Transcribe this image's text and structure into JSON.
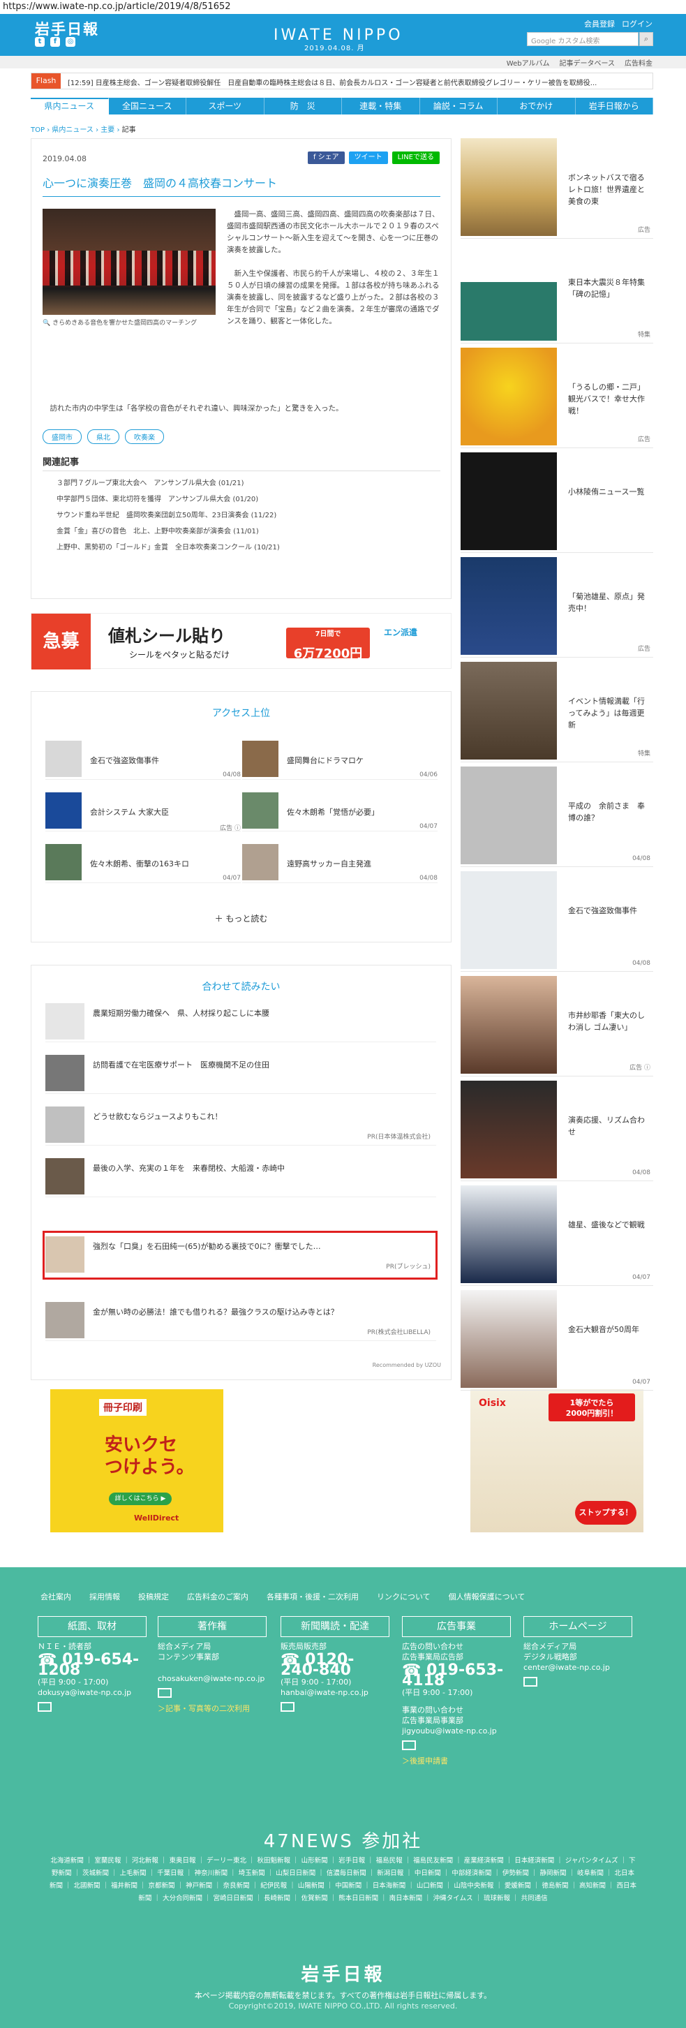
{
  "url": "https://www.iwate-np.co.jp/article/2019/4/8/51652",
  "header": {
    "logo_jp": "岩手日報",
    "logo_en": "IWATE NIPPO",
    "date": "2019.04.08. 月",
    "member_link": "会員登録",
    "login_link": "ログイン",
    "search_placeholder": "Google カスタム検索"
  },
  "subbar": {
    "links": [
      "Webアルバム",
      "記事データベース",
      "広告料金"
    ]
  },
  "flash": {
    "label": "Flash",
    "text": "[12:59] 日産株主総会、ゴーン容疑者取締役解任　日産自動車の臨時株主総会は８日、前会長カルロス・ゴーン容疑者と前代表取締役グレゴリー・ケリー被告を取締役..."
  },
  "nav": [
    "県内ニュース",
    "全国ニュース",
    "スポーツ",
    "防　災",
    "連載・特集",
    "論説・コラム",
    "おでかけ",
    "岩手日報から"
  ],
  "breadcrumb": {
    "top": "TOP",
    "sep": "›",
    "cat1": "県内ニュース",
    "cat2": "主要",
    "current": "記事"
  },
  "article": {
    "date": "2019.04.08",
    "share_fb": "f シェア",
    "share_tw": "ツイート",
    "share_line": "LINEで送る",
    "title": "心一つに演奏圧巻　盛岡の４高校春コンサート",
    "caption": "🔍 きらめきある音色を響かせた盛岡四高のマーチング",
    "body1": "　盛岡一高、盛岡三高、盛岡四高、盛岡四高の吹奏楽部は７日、盛岡市盛岡駅西通の市民文化ホール大ホールで２０１９春のスペシャルコンサート〜新入生を迎えて〜を開き、心を一つに圧巻の演奏を披露した。\n\n　新入生や保護者、市民ら約千人が来場し、４校の２、３年生１５０人が日頃の練習の成果を発揮。１部は各校が持ち味あふれる演奏を披露し、同を披露するなど盛り上がった。２部は各校の３年生が合同で「宝島」など２曲を演奏。２年生が審席の通路でダンスを踊り、観客と一体化した。",
    "body2": "　訪れた市内の中学生は「各学校の音色がそれぞれ違い、興味深かった」と驚きを入った。",
    "tags": [
      "盛岡市",
      "県北",
      "吹奏楽"
    ],
    "related_title": "関連記事",
    "related": [
      "３部門７グループ東北大会へ　アンサンブル県大会 (01/21)",
      "中学部門５団体、東北切符を獲得　アンサンブル県大会 (01/20)",
      "サウンド重ね半世紀　盛岡吹奏楽団創立50周年、23日演奏会 (11/22)",
      "金賞「金」喜びの音色　北上、上野中吹奏楽部が演奏会 (11/01)",
      "上野中、黒勢初の「ゴールド」金賞　全日本吹奏楽コンクール (10/21)"
    ]
  },
  "ad_banner": {
    "red_label": "急募",
    "main": "値札シール貼り",
    "sub": "シールをペタッと貼るだけ",
    "price": "6万7200円",
    "price_prefix": "7日間で",
    "logo": "エン派遣"
  },
  "ranking": {
    "title": "アクセス上位",
    "items": [
      {
        "text": "金石で強盗致傷事件",
        "date": "04/08"
      },
      {
        "text": "盛岡舞台にドラマロケ",
        "date": "04/06"
      },
      {
        "text": "会計システム 大家大臣",
        "date": "広告 ⓘ"
      },
      {
        "text": "佐々木朗希「覚悟が必要」",
        "date": "04/07"
      },
      {
        "text": "佐々木朗希、衝撃の163キロ",
        "date": "04/07"
      },
      {
        "text": "遠野高サッカー自主発進",
        "date": "04/08"
      }
    ],
    "more": "＋ もっと読む"
  },
  "recommend": {
    "title": "合わせて読みたい",
    "items": [
      {
        "text": "農業短期労働力確保へ　県、人材採り起こしに本腰",
        "pr": ""
      },
      {
        "text": "訪問看護で在宅医療サポート　医療機関不足の住田",
        "pr": ""
      },
      {
        "text": "どうせ飲むならジュースよりもこれ！",
        "pr": "PR(日本体温株式会社)"
      },
      {
        "text": "最後の入学、充実の１年を　来春閉校、大船渡・赤崎中",
        "pr": ""
      },
      {
        "text": "強烈な「口臭」を石田純一(65)が勧める裏技で0に？衝撃でした…",
        "pr": "PR(ブレッシュ)"
      },
      {
        "text": "金が無い時の必勝法！誰でも借りれる？最強クラスの駆け込み寺とは？",
        "pr": "PR(株式会社LIBELLA)"
      }
    ],
    "powered": "Recommended by UZOU"
  },
  "sidebar": [
    {
      "text": "ボンネットバスで宿るレトロ旅！世界遺産と美食の東",
      "tag": "広告"
    },
    {
      "text": "東日本大震災８年特集「碑の記憶」",
      "tag": "特集"
    },
    {
      "text": "「うるしの郷・二戸」観光バスで！幸せ大作戦！",
      "tag": "広告"
    },
    {
      "text": "小林陵侑ニュース一覧",
      "tag": ""
    },
    {
      "text": "「菊池雄星、原点」発売中！",
      "tag": "広告"
    },
    {
      "text": "イベント情報満載「行ってみよう」は毎週更新",
      "tag": "特集"
    },
    {
      "text": "平成の　余前さま　奉博の誰？",
      "tag": "04/08"
    },
    {
      "text": "金石で強盗致傷事件",
      "tag": "04/08"
    },
    {
      "text": "市井紗耶香「東大のしわ消し ゴム凄い」",
      "tag": "広告 ⓘ"
    },
    {
      "text": "演奏応援、リズム合わせ",
      "tag": "04/08"
    },
    {
      "text": "雄星、盛後などで観戦",
      "tag": "04/07"
    },
    {
      "text": "金石大観音が50周年",
      "tag": "04/07"
    }
  ],
  "bottom_ads": {
    "left": {
      "title": "冊子印刷",
      "main": "安いクセ\nつけよう。",
      "btn": "詳しくはこちら ▶",
      "brand": "WellDirect"
    },
    "right": {
      "logo": "Oisix",
      "top": "1等がでたら\n2000円割引！",
      "btn": "ストップする！"
    }
  },
  "footer": {
    "nav": [
      "会社案内",
      "採用情報",
      "投稿規定",
      "広告料金のご案内",
      "各種事項・後援・二次利用",
      "リンクについて",
      "個人情報保護について"
    ],
    "cols": [
      {
        "h": "紙面、取材",
        "b1": "ＮＩＥ・読者部",
        "phone": "019-654-1208",
        "hours": "(平日 9:00 - 17:00)",
        "email": "dokusya@iwate-np.co.jp",
        "link": ""
      },
      {
        "h": "著作権",
        "b1": "総合メディア局\nコンテンツ事業部",
        "phone": "",
        "hours": "",
        "email": "chosakuken@iwate-np.co.jp",
        "link": "＞記事・写真等の二次利用"
      },
      {
        "h": "新聞購読・配達",
        "b1": "販売局販売部",
        "phone": "0120-240-840",
        "hours": "(平日 9:00 - 17:00)",
        "email": "hanbai@iwate-np.co.jp",
        "link": ""
      },
      {
        "h": "広告事業",
        "b1": "広告の問い合わせ\n広告事業局広告部",
        "phone": "019-653-4118",
        "hours": "(平日 9:00 - 17:00)",
        "email": "jigyoubu@iwate-np.co.jp",
        "link": "＞後援申請書"
      },
      {
        "h": "ホームページ",
        "b1": "総合メディア局\nデジタル戦略部",
        "phone": "",
        "hours": "",
        "email": "center@iwate-np.co.jp",
        "link": ""
      }
    ],
    "col4_extra": "事業の問い合わせ\n広告事業局事業部",
    "news47_title": "47NEWS 参加社",
    "papers": "北海道新聞 ｜ 室蘭民報 ｜ 河北新報 ｜ 東奥日報 ｜ デーリー東北 ｜ 秋田魁新報 ｜ 山形新聞 ｜ 岩手日報 ｜ 福島民報 ｜ 福島民友新聞 ｜ 産業経済新聞 ｜ 日本経済新聞 ｜ ジャパンタイムズ ｜ 下野新聞 ｜ 茨城新聞 ｜ 上毛新聞 ｜ 千葉日報 ｜ 神奈川新聞 ｜ 埼玉新聞 ｜ 山梨日日新聞 ｜ 信濃毎日新聞 ｜ 新潟日報 ｜ 中日新聞 ｜ 中部経済新聞 ｜ 伊勢新聞 ｜ 静岡新聞 ｜ 岐阜新聞 ｜ 北日本新聞 ｜ 北國新聞 ｜ 福井新聞 ｜ 京都新聞 ｜ 神戸新聞 ｜ 奈良新聞 ｜ 紀伊民報 ｜ 山陽新聞 ｜ 中国新聞 ｜ 日本海新聞 ｜ 山口新聞 ｜ 山陰中央新報 ｜ 愛媛新聞 ｜ 徳島新聞 ｜ 高知新聞 ｜ 西日本新聞 ｜ 大分合同新聞 ｜ 宮崎日日新聞 ｜ 長崎新聞 ｜ 佐賀新聞 ｜ 熊本日日新聞 ｜ 南日本新聞 ｜ 沖縄タイムス ｜ 琉球新報 ｜ 共同通信",
    "logo": "岩手日報",
    "note": "本ページ掲載内容の無断転載を禁じます。すべての著作権は岩手日報社に帰属します。",
    "copyright": "Copyright©2019, IWATE NIPPO CO.,LTD. All rights reserved."
  }
}
